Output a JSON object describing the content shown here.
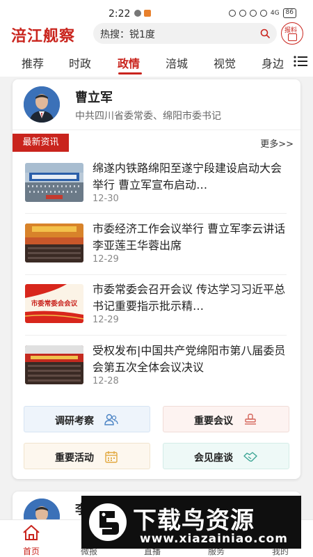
{
  "status_bar": {
    "time": "2:22",
    "network": "4G",
    "battery": "86"
  },
  "header": {
    "logo": "涪江舰察",
    "search_text": "热搜：锐1度",
    "report_label": "报料"
  },
  "tabs": [
    {
      "label": "推荐",
      "active": false
    },
    {
      "label": "时政",
      "active": false
    },
    {
      "label": "政情",
      "active": true
    },
    {
      "label": "涪城",
      "active": false
    },
    {
      "label": "视觉",
      "active": false
    },
    {
      "label": "身边",
      "active": false
    }
  ],
  "profile": {
    "name": "曹立军",
    "title": "中共四川省委常委、绵阳市委书记"
  },
  "news_section": {
    "tag": "最新资讯",
    "more": "更多>>"
  },
  "news": [
    {
      "title": "绵遂内铁路绵阳至遂宁段建设启动大会举行  曹立军宣布启动…",
      "date": "12-30"
    },
    {
      "title": "市委经济工作会议举行  曹立军李云讲话  李亚莲王华蓉出席",
      "date": "12-29"
    },
    {
      "title": "市委常委会召开会议  传达学习习近平总书记重要指示批示精…",
      "date": "12-29",
      "thumb_text": "市委常委会会议"
    },
    {
      "title": "受权发布|中国共产党绵阳市第八届委员会第五次全体会议决议",
      "date": "12-28"
    }
  ],
  "actions": [
    {
      "label": "调研考察",
      "icon": "people-icon",
      "bg": "#eef4fb",
      "border": "#d6e4f3",
      "color": "#4b83c4"
    },
    {
      "label": "重要会议",
      "icon": "stamp-icon",
      "bg": "#fdf3f1",
      "border": "#f0dcd7",
      "color": "#d4645a"
    },
    {
      "label": "重要活动",
      "icon": "calendar-icon",
      "bg": "#fdf7ee",
      "border": "#f1e4cd",
      "color": "#e2a940"
    },
    {
      "label": "会见座谈",
      "icon": "handshake-icon",
      "bg": "#eef9f7",
      "border": "#d3ece7",
      "color": "#3aa493"
    }
  ],
  "second_card": {
    "name_partial": "李"
  },
  "bottom_nav": [
    {
      "label": "首页",
      "active": true
    },
    {
      "label": "微报",
      "active": false
    },
    {
      "label": "直播",
      "active": false
    },
    {
      "label": "服务",
      "active": false
    },
    {
      "label": "我的",
      "active": false
    }
  ],
  "watermark": {
    "text": "下载鸟资源",
    "url": "www.xiazainiao.com"
  },
  "colors": {
    "brand": "#c9241d",
    "text": "#222222",
    "muted": "#888888"
  }
}
